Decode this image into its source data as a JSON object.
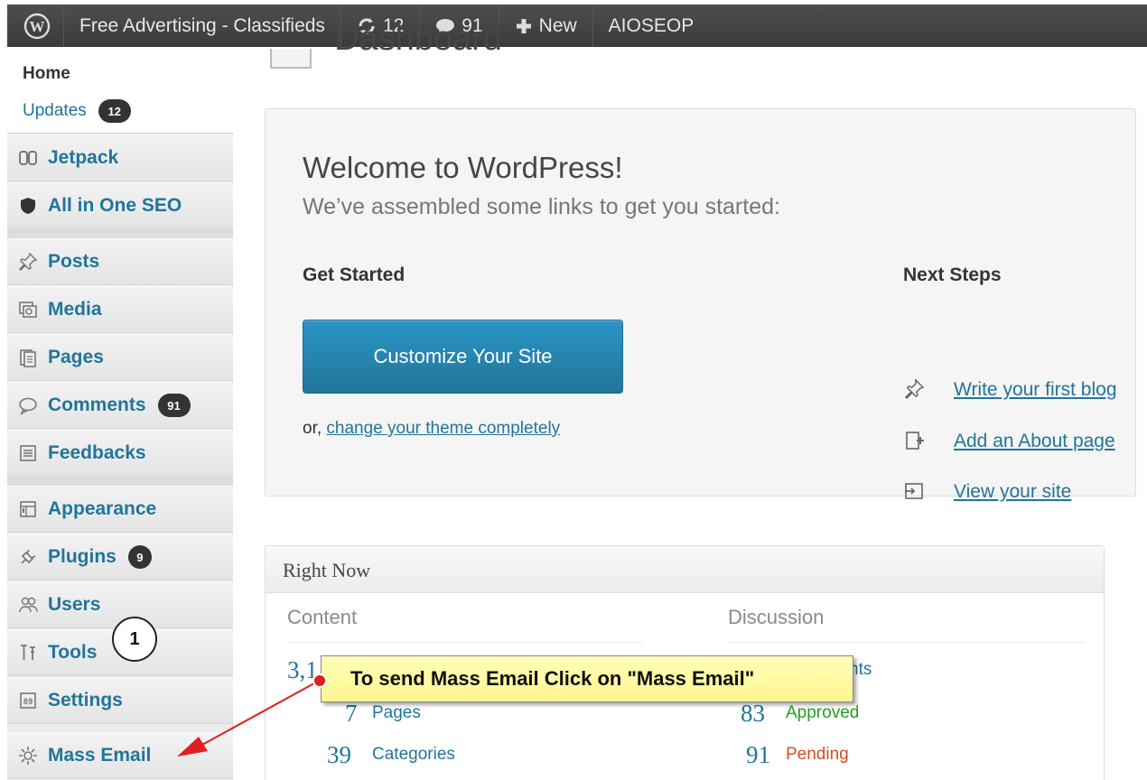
{
  "adminbar": {
    "site_name": "Free Advertising - Classifieds",
    "updates_count": "12",
    "comments_count": "91",
    "new_label": "New",
    "plugin_label": "AIOSEOP"
  },
  "sidebar": {
    "home_label": "Home",
    "updates_label": "Updates",
    "updates_badge": "12",
    "items": [
      {
        "label": "Jetpack",
        "icon": "jetpack-icon"
      },
      {
        "label": "All in One SEO",
        "icon": "shield-icon"
      },
      {
        "label": "Posts",
        "icon": "pin-icon"
      },
      {
        "label": "Media",
        "icon": "media-icon"
      },
      {
        "label": "Pages",
        "icon": "pages-icon"
      },
      {
        "label": "Comments",
        "icon": "comment-icon",
        "badge": "91"
      },
      {
        "label": "Feedbacks",
        "icon": "feedback-icon"
      },
      {
        "label": "Appearance",
        "icon": "appearance-icon"
      },
      {
        "label": "Plugins",
        "icon": "plugin-icon",
        "badge": "9"
      },
      {
        "label": "Users",
        "icon": "users-icon"
      },
      {
        "label": "Tools",
        "icon": "tools-icon"
      },
      {
        "label": "Settings",
        "icon": "settings-icon"
      },
      {
        "label": "Mass Email",
        "icon": "gear-icon"
      }
    ]
  },
  "main": {
    "page_title": "Dashboard",
    "welcome": {
      "title": "Welcome to WordPress!",
      "subtitle": "We’ve assembled some links to get you started:",
      "get_started": "Get Started",
      "next_steps": "Next Steps",
      "customize_button": "Customize Your Site",
      "or_prefix": "or,",
      "change_theme_link": "change your theme completely",
      "steps": [
        {
          "label": "Write your first blog",
          "icon": "write-icon"
        },
        {
          "label": "Add an About page",
          "icon": "add-page-icon"
        },
        {
          "label": "View your site",
          "icon": "view-site-icon"
        }
      ]
    },
    "right_now": {
      "title": "Right Now",
      "content_col": "Content",
      "discussion_col": "Discussion",
      "content_rows": [
        {
          "num": "3,1",
          "label": ""
        },
        {
          "num": "7",
          "label": "Pages"
        },
        {
          "num": "39",
          "label": "Categories"
        }
      ],
      "discussion_rows": [
        {
          "num": "",
          "label": "nts"
        },
        {
          "num": "83",
          "label": "Approved"
        },
        {
          "num": "91",
          "label": "Pending"
        }
      ]
    }
  },
  "annotation": {
    "callout_text": "To send Mass Email Click on \"Mass Email\"",
    "step_number": "1"
  }
}
